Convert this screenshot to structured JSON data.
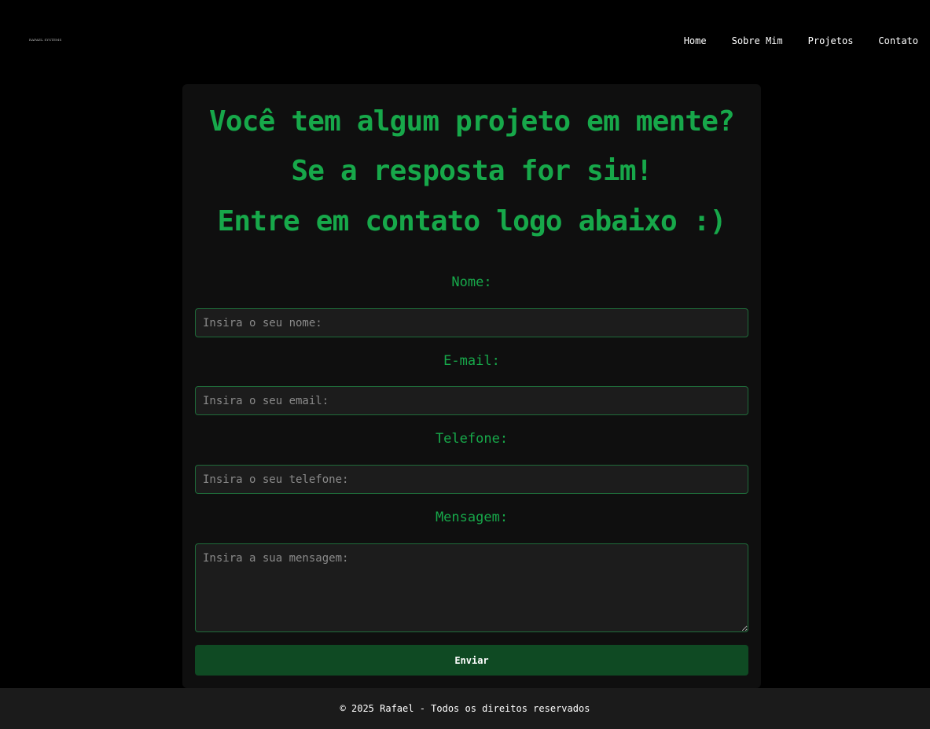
{
  "header": {
    "logo_text": "RAFAEL SYSTEMS",
    "nav": [
      {
        "label": "Home"
      },
      {
        "label": "Sobre Mim"
      },
      {
        "label": "Projetos"
      },
      {
        "label": "Contato"
      }
    ]
  },
  "main": {
    "headline_1": "Você tem algum projeto em mente?",
    "headline_2": "Se a resposta for sim!",
    "headline_3": "Entre em contato logo abaixo :)",
    "form": {
      "name_label": "Nome:",
      "name_placeholder": "Insira o seu nome:",
      "email_label": "E-mail:",
      "email_placeholder": "Insira o seu email:",
      "phone_label": "Telefone:",
      "phone_placeholder": "Insira o seu telefone:",
      "message_label": "Mensagem:",
      "message_placeholder": "Insira a sua mensagem:",
      "submit_label": "Enviar"
    }
  },
  "footer": {
    "text": "© 2025 Rafael - Todos os direitos reservados"
  },
  "colors": {
    "background": "#000000",
    "accent_green": "#17a84a",
    "card": "#0f0f0f",
    "button": "#0f4a23",
    "footer": "#1b1b1b"
  }
}
